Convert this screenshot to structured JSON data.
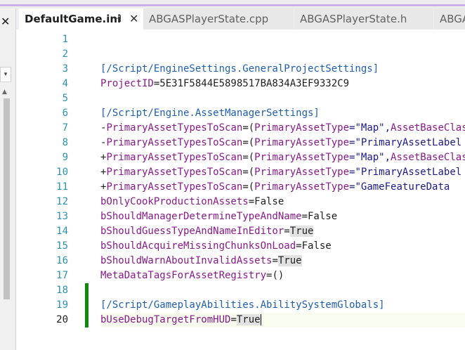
{
  "tabs": [
    {
      "label": "DefaultGame.ini",
      "active": true
    },
    {
      "label": "ABGASPlayerState.cpp",
      "active": false
    },
    {
      "label": "ABGASPlayerState.h",
      "active": false
    },
    {
      "label": "ABGA",
      "active": false
    }
  ],
  "tab_pin_glyph": "⊣",
  "tab_close_glyph": "✕",
  "left_panel": {
    "close_glyph": "✕",
    "dropdown_glyph": "▾",
    "scroll_up_glyph": "▲"
  },
  "editor": {
    "current_line": 20,
    "lines": [
      {
        "n": "1",
        "segments": []
      },
      {
        "n": "2",
        "segments": []
      },
      {
        "n": "3",
        "segments": [
          {
            "t": "[/Script/EngineSettings.GeneralProjectSettings]",
            "c": "sec"
          }
        ]
      },
      {
        "n": "4",
        "segments": [
          {
            "t": "ProjectID",
            "c": "key"
          },
          {
            "t": "=5E31F5844E5898517BA834A3EF9332C9",
            "c": "plain"
          }
        ]
      },
      {
        "n": "5",
        "segments": []
      },
      {
        "n": "6",
        "segments": [
          {
            "t": "[/Script/Engine.AssetManagerSettings]",
            "c": "sec"
          }
        ]
      },
      {
        "n": "7",
        "segments": [
          {
            "t": "-",
            "c": "plain"
          },
          {
            "t": "PrimaryAssetTypesToScan",
            "c": "key"
          },
          {
            "t": "=(",
            "c": "plain"
          },
          {
            "t": "PrimaryAssetType",
            "c": "key"
          },
          {
            "t": "=\"Map\",",
            "c": "str"
          },
          {
            "t": "AssetBaseClass",
            "c": "key"
          }
        ]
      },
      {
        "n": "8",
        "segments": [
          {
            "t": "-",
            "c": "plain"
          },
          {
            "t": "PrimaryAssetTypesToScan",
            "c": "key"
          },
          {
            "t": "=(",
            "c": "plain"
          },
          {
            "t": "PrimaryAssetType",
            "c": "key"
          },
          {
            "t": "=\"",
            "c": "str"
          },
          {
            "t": "PrimaryAssetLabel",
            "c": "str"
          }
        ]
      },
      {
        "n": "9",
        "segments": [
          {
            "t": "+",
            "c": "plain"
          },
          {
            "t": "PrimaryAssetTypesToScan",
            "c": "key"
          },
          {
            "t": "=(",
            "c": "plain"
          },
          {
            "t": "PrimaryAssetType",
            "c": "key"
          },
          {
            "t": "=\"Map\",",
            "c": "str"
          },
          {
            "t": "AssetBaseClass",
            "c": "key"
          }
        ]
      },
      {
        "n": "10",
        "segments": [
          {
            "t": "+",
            "c": "plain"
          },
          {
            "t": "PrimaryAssetTypesToScan",
            "c": "key"
          },
          {
            "t": "=(",
            "c": "plain"
          },
          {
            "t": "PrimaryAssetType",
            "c": "key"
          },
          {
            "t": "=\"",
            "c": "str"
          },
          {
            "t": "PrimaryAssetLabel",
            "c": "str"
          }
        ]
      },
      {
        "n": "11",
        "segments": [
          {
            "t": "+",
            "c": "plain"
          },
          {
            "t": "PrimaryAssetTypesToScan",
            "c": "key"
          },
          {
            "t": "=(",
            "c": "plain"
          },
          {
            "t": "PrimaryAssetType",
            "c": "key"
          },
          {
            "t": "=\"",
            "c": "str"
          },
          {
            "t": "GameFeatureData",
            "c": "str"
          }
        ]
      },
      {
        "n": "12",
        "segments": [
          {
            "t": "bOnlyCookProductionAssets",
            "c": "key"
          },
          {
            "t": "=False",
            "c": "plain"
          }
        ]
      },
      {
        "n": "13",
        "segments": [
          {
            "t": "bShouldManagerDetermineTypeAndName",
            "c": "key"
          },
          {
            "t": "=False",
            "c": "plain"
          }
        ]
      },
      {
        "n": "14",
        "segments": [
          {
            "t": "bShouldGuessTypeAndNameInEditor",
            "c": "key"
          },
          {
            "t": "=",
            "c": "plain"
          },
          {
            "t": "True",
            "c": "plain",
            "hl": true
          }
        ]
      },
      {
        "n": "15",
        "segments": [
          {
            "t": "bShouldAcquireMissingChunksOnLoad",
            "c": "key"
          },
          {
            "t": "=False",
            "c": "plain"
          }
        ]
      },
      {
        "n": "16",
        "segments": [
          {
            "t": "bShouldWarnAboutInvalidAssets",
            "c": "key"
          },
          {
            "t": "=",
            "c": "plain"
          },
          {
            "t": "True",
            "c": "plain",
            "hl": true
          }
        ]
      },
      {
        "n": "17",
        "segments": [
          {
            "t": "MetaDataTagsForAssetRegistry",
            "c": "key"
          },
          {
            "t": "=()",
            "c": "plain"
          }
        ]
      },
      {
        "n": "18",
        "segments": [],
        "changed": true
      },
      {
        "n": "19",
        "segments": [
          {
            "t": "[/Script/GameplayAbilities.AbilitySystemGlobals]",
            "c": "sec"
          }
        ],
        "changed": true
      },
      {
        "n": "20",
        "segments": [
          {
            "t": "bUseDebugTargetFromHUD",
            "c": "key"
          },
          {
            "t": "=",
            "c": "plain"
          },
          {
            "t": "True",
            "c": "plain",
            "hl": true
          }
        ],
        "changed": true,
        "caret": true
      }
    ]
  }
}
